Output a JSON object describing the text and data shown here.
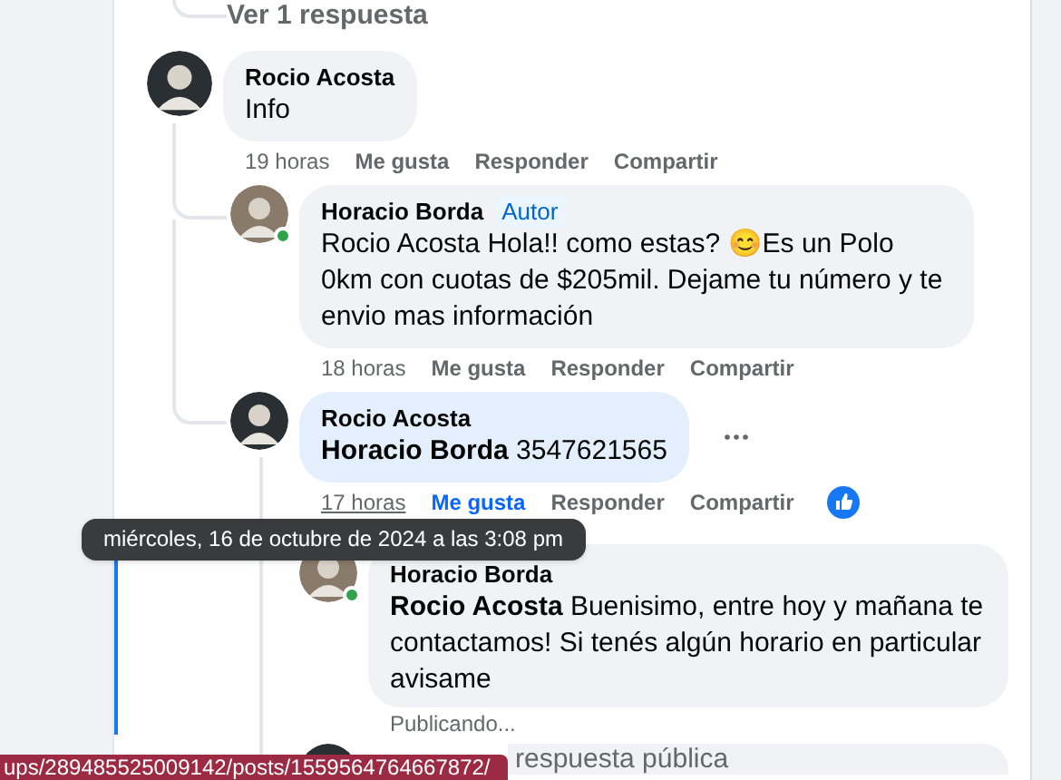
{
  "view_replies_link": "Ver 1 respuesta",
  "comments": [
    {
      "author": "Rocio Acosta",
      "text": "Info",
      "highlighted": false,
      "time": "19 horas",
      "time_hovered": false,
      "like": "Me gusta",
      "liked": false,
      "reply": "Responder",
      "share": "Compartir",
      "replies": [
        {
          "author": "Horacio Borda",
          "online": true,
          "badge": "Autor",
          "text": "Rocio Acosta Hola!! como estas? 😊Es un Polo 0km con cuotas de $205mil. Dejame tu número y te envio mas información",
          "highlighted": false,
          "time": "18 horas",
          "time_hovered": false,
          "like": "Me gusta",
          "liked": false,
          "reply": "Responder",
          "share": "Compartir"
        },
        {
          "author": "Rocio Acosta",
          "text": "**Horacio Borda** 3547621565",
          "highlighted": true,
          "time": "17 horas",
          "time_hovered": true,
          "like": "Me gusta",
          "liked": true,
          "reply": "Responder",
          "share": "Compartir",
          "more_button": true,
          "replies": [
            {
              "author": "Horacio Borda",
              "online": true,
              "text": "**Rocio Acosta** Buenisimo, entre hoy y mañana te contactamos! Si tenés algún horario en particular avisame",
              "highlighted": false,
              "status": "Publicando..."
            }
          ],
          "reply_field": {
            "placeholder": "respuesta pública"
          }
        }
      ]
    }
  ],
  "tooltip": "miércoles, 16 de octubre de 2024 a las 3:08 pm",
  "status_url": "ups/289485525009142/posts/1559564764667872/"
}
